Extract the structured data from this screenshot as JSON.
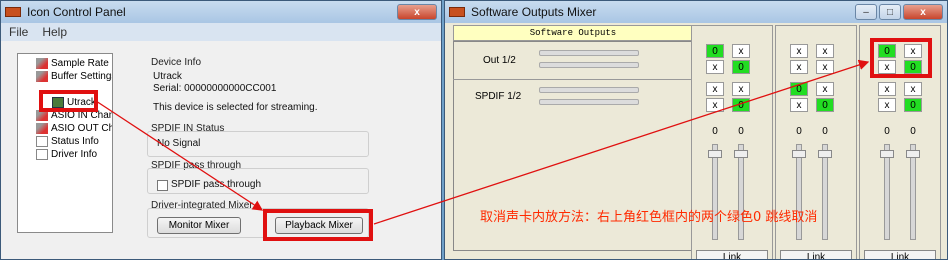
{
  "icp": {
    "title": "Icon Control Panel",
    "menu": [
      "File",
      "Help"
    ],
    "tree": [
      {
        "label": "Sample Rate"
      },
      {
        "label": "Buffer Settings"
      },
      {
        "label": "Utrack"
      },
      {
        "label": "ASIO IN Channe"
      },
      {
        "label": "ASIO OUT Chan"
      },
      {
        "label": "Status Info"
      },
      {
        "label": "Driver Info"
      }
    ],
    "device_info_label": "Device Info",
    "device_name": "Utrack",
    "serial": "Serial: 00000000000CC001",
    "streaming_note": "This device is selected for streaming.",
    "spdif_in_label": "SPDIF IN Status",
    "spdif_in_status": "No Signal",
    "spdif_pass_label": "SPDIF pass through",
    "spdif_pass_checkbox": "SPDIF pass through",
    "mixer_label": "Driver-integrated Mixer",
    "monitor_btn": "Monitor Mixer",
    "playback_btn": "Playback Mixer",
    "close_glyph": "x"
  },
  "mixer": {
    "title": "Software Outputs Mixer",
    "header": "Software Outputs",
    "rows": [
      "Out 1/2",
      "SPDIF 1/2"
    ],
    "min_glyph": "–",
    "max_glyph": "□",
    "close_glyph": "x",
    "strips": [
      {
        "cells": [
          "0",
          "x",
          "x",
          "0",
          "x",
          "x",
          "x",
          "0"
        ],
        "levels": [
          "0",
          "0"
        ],
        "link": "Link"
      },
      {
        "cells": [
          "x",
          "x",
          "x",
          "x",
          "0",
          "x",
          "x",
          "0"
        ],
        "levels": [
          "0",
          "0"
        ],
        "link": "Link"
      },
      {
        "cells": [
          "0",
          "x",
          "x",
          "0",
          "x",
          "x",
          "x",
          "0"
        ],
        "levels": [
          "0",
          "0"
        ],
        "link": "Link"
      }
    ]
  },
  "annotation": "取消声卡内放方法：右上角红色框内的两个绿色0 跳线取消"
}
